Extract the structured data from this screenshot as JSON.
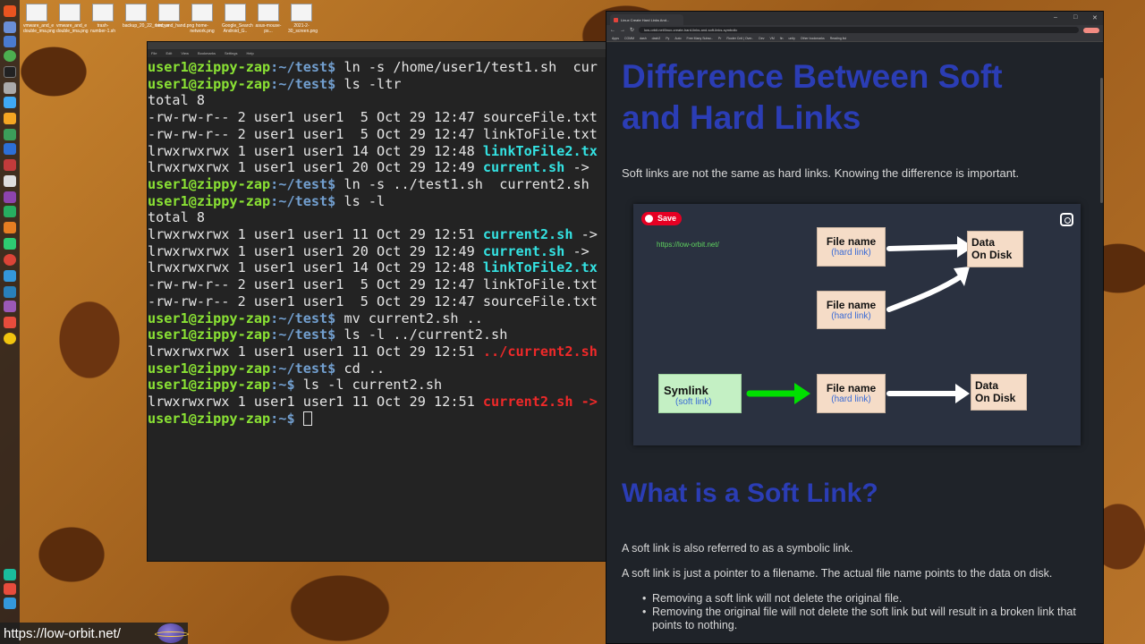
{
  "desktop": {
    "files": [
      {
        "caption": "vmware_and_e double_ima.png"
      },
      {
        "caption": "vmware_and_e double_ima.png"
      },
      {
        "caption": "trash-number-1.sh"
      },
      {
        "caption": "backup_20_22_remove"
      },
      {
        "caption": "bird_and_hand.png"
      },
      {
        "caption": "home-network.png"
      },
      {
        "caption": "Google_Search Android_G.."
      },
      {
        "caption": "asus-mouse-ps..."
      },
      {
        "caption": "2021-2-30_screen.png"
      }
    ]
  },
  "terminal": {
    "menu": [
      "File",
      "Edit",
      "View",
      "Bookmarks",
      "Settings",
      "Help"
    ],
    "prompt_user": "user1@zippy-zap",
    "lines": [
      {
        "dir": ":~/test",
        "cmd": " ln -s /home/user1/test1.sh  cur"
      },
      {
        "dir": ":~/test",
        "cmd": " ls -ltr"
      },
      {
        "plain": "total 8"
      },
      {
        "plain": "-rw-rw-r-- 2 user1 user1  5 Oct 29 12:47 ",
        "file": "sourceFile.txt",
        "cls": "n"
      },
      {
        "plain": "-rw-rw-r-- 2 user1 user1  5 Oct 29 12:47 ",
        "file": "linkToFile.txt",
        "cls": "n"
      },
      {
        "plain": "lrwxrwxrwx 1 user1 user1 14 Oct 29 12:48 ",
        "file": "linkToFile2.tx",
        "cls": "cyan"
      },
      {
        "plain": "lrwxrwxrwx 1 user1 user1 20 Oct 29 12:49 ",
        "file": "current.sh",
        "cls": "cyan",
        "tail": " ->"
      },
      {
        "dir": ":~/test",
        "cmd": " ln -s ../test1.sh  current2.sh"
      },
      {
        "dir": ":~/test",
        "cmd": " ls -l"
      },
      {
        "plain": "total 8"
      },
      {
        "plain": "lrwxrwxrwx 1 user1 user1 11 Oct 29 12:51 ",
        "file": "current2.sh",
        "cls": "cyan",
        "tail": " ->"
      },
      {
        "plain": "lrwxrwxrwx 1 user1 user1 20 Oct 29 12:49 ",
        "file": "current.sh",
        "cls": "cyan",
        "tail": " ->"
      },
      {
        "plain": "lrwxrwxrwx 1 user1 user1 14 Oct 29 12:48 ",
        "file": "linkToFile2.tx",
        "cls": "cyan"
      },
      {
        "plain": "-rw-rw-r-- 2 user1 user1  5 Oct 29 12:47 ",
        "file": "linkToFile.txt",
        "cls": "n"
      },
      {
        "plain": "-rw-rw-r-- 2 user1 user1  5 Oct 29 12:47 ",
        "file": "sourceFile.txt",
        "cls": "n"
      },
      {
        "dir": ":~/test",
        "cmd": " mv current2.sh .."
      },
      {
        "dir": ":~/test",
        "cmd": " ls -l ../current2.sh"
      },
      {
        "plain": "lrwxrwxrwx 1 user1 user1 11 Oct 29 12:51 ",
        "file": "../current2.sh",
        "cls": "red"
      },
      {
        "dir": ":~/test",
        "cmd": " cd .."
      },
      {
        "dir": ":~",
        "cmd": " ls -l current2.sh"
      },
      {
        "plain": "lrwxrwxrwx 1 user1 user1 11 Oct 29 12:51 ",
        "file": "current2.sh",
        "cls": "red",
        "tail": " ->"
      },
      {
        "dir": ":~",
        "cmd": " ",
        "cursor": true
      }
    ]
  },
  "browser": {
    "tab_title": "Linux Create Hard Links And...",
    "url": "low-orbit.net/linux-create-hard-links-and-soft-links-symbolic",
    "bookmarks": [
      "Apps",
      "COMM",
      "dash",
      "dash2",
      "Py",
      "Auto",
      "Free Many Subsc..",
      "Pr",
      "Rooter Cntl | Over..",
      "Dev",
      "VM",
      "fin",
      "unity",
      "Other bookmarks",
      "Reading list"
    ],
    "page": {
      "heading": "Difference Between Soft and Hard Links",
      "intro": "Soft links are not the same as hard links. Knowing the difference is important.",
      "diagram": {
        "save_label": "Save",
        "url": "https://low-orbit.net/",
        "file_name": "File name",
        "hard_link": "(hard link)",
        "data_on_disk_1": "Data",
        "data_on_disk_2": "On Disk",
        "symlink": "Symlink",
        "soft_link": "(soft link)"
      },
      "soft_heading": "What is a Soft Link?",
      "soft_p1": "A soft link is also referred to as a symbolic link.",
      "soft_p2": "A soft link is just a pointer to a filename. The actual file name points to the data on disk.",
      "bullets": [
        "Removing a soft link will not delete the original file.",
        "Removing the original file will not delete the soft link but will result in a broken link that points to nothing."
      ]
    }
  },
  "watermark": {
    "text": "https://low-orbit.net/"
  }
}
